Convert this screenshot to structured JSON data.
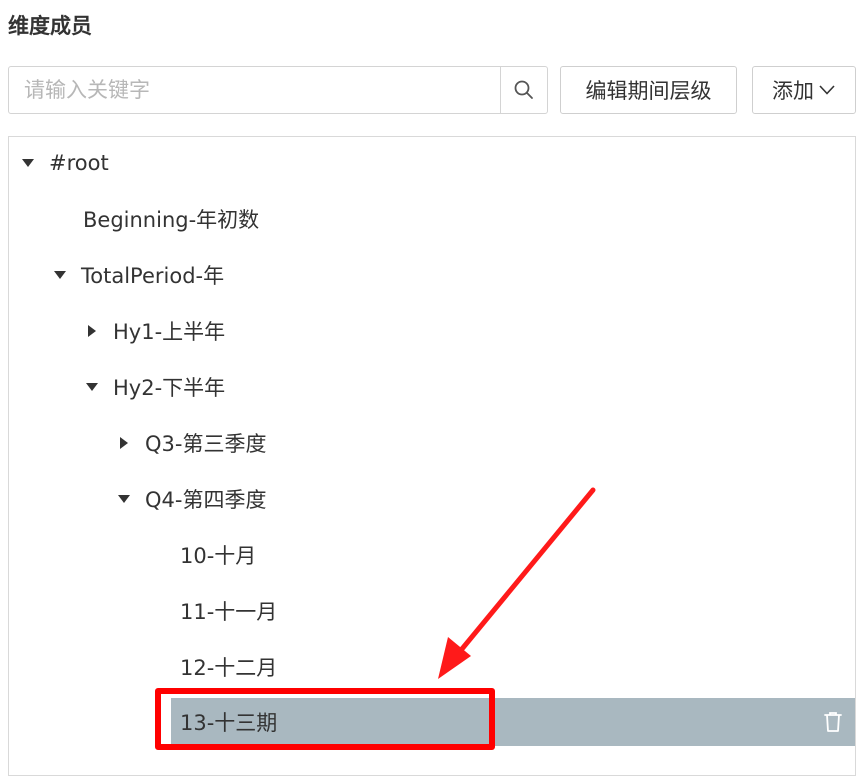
{
  "panel": {
    "title": "维度成员"
  },
  "search": {
    "placeholder": "请输入关键字",
    "value": ""
  },
  "toolbar": {
    "edit_period_level_label": "编辑期间层级",
    "add_label": "添加"
  },
  "tree": {
    "root": "#root",
    "beginning": "Beginning-年初数",
    "total_period": "TotalPeriod-年",
    "hy1": "Hy1-上半年",
    "hy2": "Hy2-下半年",
    "q3": "Q3-第三季度",
    "q4": "Q4-第四季度",
    "m10": "10-十月",
    "m11": "11-十一月",
    "m12": "12-十二月",
    "m13": "13-十三期"
  },
  "colors": {
    "selected_row": "#a9b8c0",
    "highlight": "#ff0000"
  },
  "icons": {
    "search": "search-icon",
    "dropdown": "chevron-down-icon",
    "expanded": "caret-down-icon",
    "collapsed": "caret-right-icon",
    "delete": "trash-icon"
  }
}
